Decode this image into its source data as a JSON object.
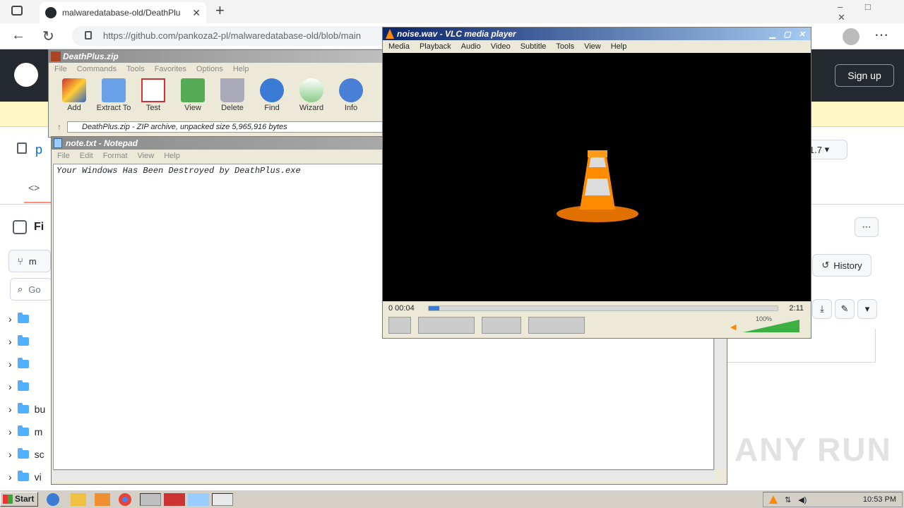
{
  "browser": {
    "tab_title": "malwaredatabase-old/DeathPlu",
    "url": "https://github.com/pankoza2-pl/malwaredatabase-old/blob/main",
    "signup_label": "Sign up",
    "new_tab_symbol": "+"
  },
  "github": {
    "repo_initial": "p",
    "code_tab_fragment": "<>",
    "sidebar_title_fragment": "Fi",
    "branch_fragment": "m",
    "search_fragment": "Go",
    "history_label": "History",
    "files": [
      {
        "name": ""
      },
      {
        "name": ""
      },
      {
        "name": ""
      },
      {
        "name": ""
      },
      {
        "name": "bu"
      },
      {
        "name": "m"
      },
      {
        "name": "sc"
      },
      {
        "name": "vi"
      }
    ],
    "watermark": "ANY RUN",
    "box_label": "1.7"
  },
  "winrar": {
    "title": "DeathPlus.zip",
    "menu": [
      "File",
      "Commands",
      "Tools",
      "Favorites",
      "Options",
      "Help"
    ],
    "toolbar": [
      "Add",
      "Extract To",
      "Test",
      "View",
      "Delete",
      "Find",
      "Wizard",
      "Info"
    ],
    "path": "DeathPlus.zip - ZIP archive, unpacked size 5,965,916 bytes"
  },
  "notepad": {
    "title": "note.txt - Notepad",
    "menu": [
      "File",
      "Edit",
      "Format",
      "View",
      "Help"
    ],
    "content": "Your Windows Has Been Destroyed by DeathPlus.exe"
  },
  "vlc": {
    "title": "noise.wav - VLC media player",
    "menu": [
      "Media",
      "Playback",
      "Audio",
      "Video",
      "Subtitle",
      "Tools",
      "View",
      "Help"
    ],
    "time_elapsed": "0 00:04",
    "time_total": "2:11",
    "volume": "100%",
    "progress_fraction": 0.03
  },
  "taskbar": {
    "start_label": "Start",
    "clock": "10:53 PM"
  },
  "colors": {
    "github_header": "#24292f",
    "banner": "#fff8c5",
    "xp_title": "#0a246a",
    "vlc_orange": "#ff8800"
  }
}
